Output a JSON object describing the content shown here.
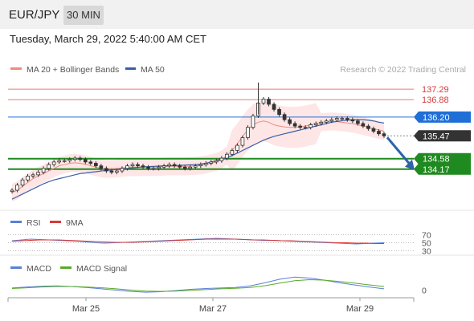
{
  "header": {
    "symbol": "EUR/JPY",
    "timeframe": "30 MIN",
    "datetime": "Tuesday, March 29, 2022 5:40:00 AM CET"
  },
  "legend": {
    "ma20": "MA 20 + Bollinger Bands",
    "ma50": "MA 50",
    "credit": "Research © 2022 Trading Central",
    "rsi": "RSI",
    "rsi_ma": "9MA",
    "macd": "MACD",
    "macd_signal": "MACD Signal"
  },
  "colors": {
    "up": "#3a3a3a",
    "down": "#3a3a3a",
    "ma20": "#f08a80",
    "bb_fill": "#fce0de",
    "ma50": "#3a5fa8",
    "resistance": "#e87a70",
    "support": "#1f8a1f",
    "pivot": "#1f6fd6",
    "last": "#333333",
    "arrow": "#2c64a8",
    "rsi": "#5b7fd6",
    "rsi_ma": "#d63a3a",
    "macd": "#5b7fd6",
    "macd_signal": "#5aaa2a"
  },
  "chart_data": [
    {
      "type": "line",
      "title": "EUR/JPY 30 MIN",
      "x_labels": [
        "Mar 25",
        "Mar 27",
        "Mar 29"
      ],
      "series": [
        {
          "name": "Close",
          "values": [
            133.35,
            133.55,
            133.75,
            133.9,
            133.95,
            134.05,
            134.2,
            134.35,
            134.45,
            134.5,
            134.5,
            134.55,
            134.6,
            134.55,
            134.45,
            134.4,
            134.3,
            134.2,
            134.1,
            134.05,
            134.1,
            134.2,
            134.3,
            134.35,
            134.3,
            134.25,
            134.2,
            134.2,
            134.25,
            134.3,
            134.35,
            134.3,
            134.25,
            134.2,
            134.25,
            134.3,
            134.35,
            134.4,
            134.45,
            134.5,
            134.6,
            134.75,
            134.9,
            135.1,
            135.4,
            135.8,
            136.25,
            136.75,
            136.9,
            136.7,
            136.5,
            136.3,
            136.1,
            135.95,
            135.85,
            135.8,
            135.8,
            135.9,
            135.95,
            136.0,
            136.05,
            136.1,
            136.15,
            136.15,
            136.1,
            136.05,
            135.95,
            135.85,
            135.75,
            135.65,
            135.55,
            135.47
          ]
        },
        {
          "name": "MA 20",
          "values": [
            133.25,
            133.35,
            133.5,
            133.65,
            133.8,
            133.9,
            134.0,
            134.1,
            134.2,
            134.3,
            134.35,
            134.4,
            134.42,
            134.4,
            134.36,
            134.3,
            134.25,
            134.2,
            134.18,
            134.18,
            134.2,
            134.22,
            134.24,
            134.25,
            134.25,
            134.25,
            134.25,
            134.25,
            134.26,
            134.27,
            134.28,
            134.28,
            134.28,
            134.28,
            134.29,
            134.3,
            134.32,
            134.35,
            134.4,
            134.45,
            134.55,
            134.7,
            134.9,
            135.15,
            135.45,
            135.7,
            135.9,
            136.0,
            136.05,
            136.0,
            135.9,
            135.85,
            135.82,
            135.8,
            135.8,
            135.82,
            135.85,
            135.9,
            135.95,
            136.0,
            136.02,
            136.03,
            136.02,
            136.0,
            135.97,
            135.95,
            135.9,
            135.85,
            135.8,
            135.75,
            135.7,
            135.65
          ]
        },
        {
          "name": "MA 50",
          "values": [
            133.0,
            133.1,
            133.2,
            133.3,
            133.4,
            133.5,
            133.6,
            133.68,
            133.75,
            133.8,
            133.85,
            133.9,
            133.95,
            134.0,
            134.02,
            134.05,
            134.07,
            134.1,
            134.12,
            134.14,
            134.16,
            134.18,
            134.2,
            134.22,
            134.24,
            134.26,
            134.27,
            134.28,
            134.29,
            134.3,
            134.3,
            134.31,
            134.32,
            134.33,
            134.34,
            134.35,
            134.37,
            134.4,
            134.45,
            134.5,
            134.56,
            134.62,
            134.7,
            134.8,
            134.9,
            135.0,
            135.1,
            135.2,
            135.3,
            135.38,
            135.45,
            135.5,
            135.55,
            135.6,
            135.65,
            135.7,
            135.75,
            135.8,
            135.85,
            135.9,
            135.95,
            136.0,
            136.03,
            136.06,
            136.08,
            136.1,
            136.1,
            136.1,
            136.08,
            136.05,
            136.0,
            135.97
          ]
        }
      ],
      "levels": [
        {
          "label": "137.29",
          "value": 137.29,
          "role": "resistance"
        },
        {
          "label": "136.88",
          "value": 136.88,
          "role": "resistance"
        },
        {
          "label": "136.20",
          "value": 136.2,
          "role": "pivot"
        },
        {
          "label": "135.47",
          "value": 135.47,
          "role": "last"
        },
        {
          "label": "134.58",
          "value": 134.58,
          "role": "support"
        },
        {
          "label": "134.17",
          "value": 134.17,
          "role": "support"
        }
      ],
      "forecast_arrow": {
        "from": 135.47,
        "to": 134.17
      },
      "ylim": [
        133.1,
        137.7
      ]
    },
    {
      "type": "line",
      "title": "RSI",
      "tick_labels": [
        "70",
        "50",
        "30"
      ],
      "series": [
        {
          "name": "RSI",
          "values": [
            55,
            57,
            59,
            58,
            57,
            56,
            55,
            54,
            52,
            50,
            49,
            50,
            51,
            52,
            53,
            54,
            55,
            56,
            57,
            58,
            59,
            60,
            61,
            60,
            59,
            58,
            57,
            56,
            56,
            55,
            54,
            53,
            52,
            51,
            50,
            49,
            48,
            47,
            48,
            49,
            50
          ]
        },
        {
          "name": "9MA",
          "values": [
            54,
            55,
            56,
            57,
            57,
            57,
            56,
            55,
            54,
            53,
            52,
            51,
            51,
            51,
            52,
            53,
            54,
            55,
            56,
            57,
            58,
            59,
            59,
            59,
            59,
            58,
            57,
            57,
            56,
            55,
            55,
            54,
            53,
            52,
            51,
            50,
            50,
            49,
            49,
            48,
            48
          ]
        }
      ],
      "ylim": [
        25,
        75
      ]
    },
    {
      "type": "line",
      "title": "MACD",
      "tick_labels": [
        "0"
      ],
      "series": [
        {
          "name": "MACD",
          "values": [
            0.08,
            0.12,
            0.15,
            0.16,
            0.14,
            0.1,
            0.05,
            0.0,
            -0.05,
            -0.08,
            -0.06,
            -0.02,
            0.03,
            0.06,
            0.08,
            0.1,
            0.16,
            0.28,
            0.42,
            0.5,
            0.46,
            0.38,
            0.28,
            0.2,
            0.12,
            0.05
          ]
        },
        {
          "name": "MACD Signal",
          "values": [
            0.06,
            0.09,
            0.12,
            0.14,
            0.14,
            0.12,
            0.09,
            0.05,
            0.0,
            -0.04,
            -0.05,
            -0.04,
            -0.01,
            0.02,
            0.05,
            0.07,
            0.1,
            0.17,
            0.27,
            0.36,
            0.4,
            0.38,
            0.33,
            0.27,
            0.2,
            0.14
          ]
        }
      ],
      "ylim": [
        -0.2,
        0.6
      ]
    }
  ]
}
